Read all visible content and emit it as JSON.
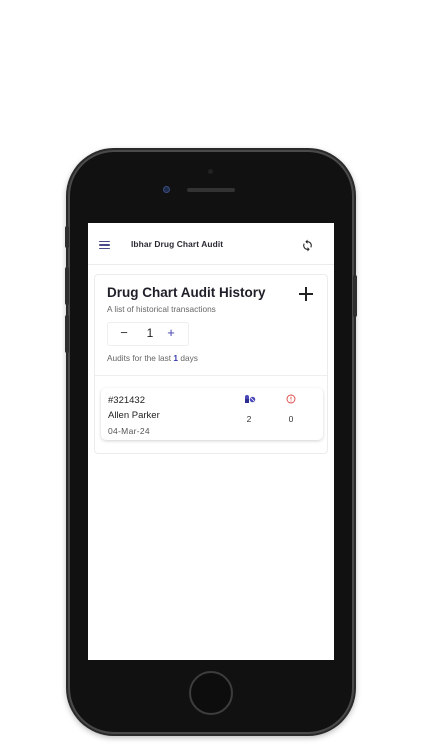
{
  "app": {
    "title": "Ibhar Drug Chart Audit",
    "accent_color": "#3a3ab0"
  },
  "icons": {
    "menu": "hamburger-menu-icon",
    "sync": "sync-icon",
    "add": "plus-icon",
    "medication": "pill-icon",
    "alert": "alert-circle-icon"
  },
  "history": {
    "title": "Drug Chart Audit History",
    "subtitle": "A list of historical transactions",
    "stepper": {
      "minus_label": "−",
      "value": "1",
      "plus_label": "+"
    },
    "audits_prefix": "Audits for the last",
    "audits_days": "1",
    "audits_suffix": "days"
  },
  "audits": [
    {
      "id": "#321432",
      "name": "Allen Parker",
      "date": "04-Mar-24",
      "medication_count": "2",
      "alert_count": "0"
    }
  ]
}
